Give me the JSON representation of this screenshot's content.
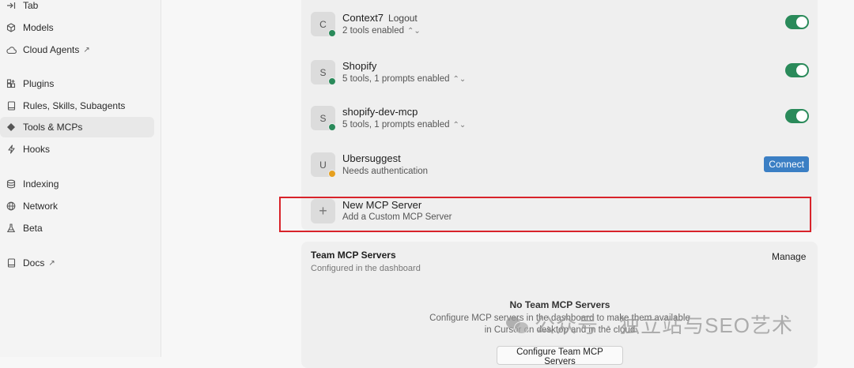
{
  "sidebar": {
    "items": [
      {
        "label": "Tab",
        "icon": "tab-arrow-icon",
        "external": false,
        "active": false
      },
      {
        "label": "Models",
        "icon": "cube-icon",
        "external": false,
        "active": false
      },
      {
        "label": "Cloud Agents",
        "icon": "cloud-icon",
        "external": true,
        "active": false
      },
      {
        "label": "Plugins",
        "icon": "plugins-icon",
        "external": false,
        "active": false
      },
      {
        "label": "Rules, Skills, Subagents",
        "icon": "book-icon",
        "external": false,
        "active": false
      },
      {
        "label": "Tools & MCPs",
        "icon": "tools-icon",
        "external": false,
        "active": true
      },
      {
        "label": "Hooks",
        "icon": "bolt-icon",
        "external": false,
        "active": false
      },
      {
        "label": "Indexing",
        "icon": "database-icon",
        "external": false,
        "active": false
      },
      {
        "label": "Network",
        "icon": "globe-icon",
        "external": false,
        "active": false
      },
      {
        "label": "Beta",
        "icon": "flask-icon",
        "external": false,
        "active": false
      },
      {
        "label": "Docs",
        "icon": "docs-icon",
        "external": true,
        "active": false
      }
    ],
    "external_glyph": "↗"
  },
  "servers": [
    {
      "initial": "C",
      "name": "Context7",
      "action": "Logout",
      "status": "2 tools enabled",
      "status_color": "#2a8a5a",
      "control": "toggle",
      "enabled": true
    },
    {
      "initial": "S",
      "name": "Shopify",
      "status": "5 tools, 1 prompts enabled",
      "status_color": "#2a8a5a",
      "control": "toggle",
      "enabled": true
    },
    {
      "initial": "S",
      "name": "shopify-dev-mcp",
      "status": "5 tools, 1 prompts enabled",
      "status_color": "#2a8a5a",
      "control": "toggle",
      "enabled": true
    },
    {
      "initial": "U",
      "name": "Ubersuggest",
      "status": "Needs authentication",
      "status_color": "#e6a020",
      "control": "button",
      "button_label": "Connect"
    }
  ],
  "new_server": {
    "icon": "+",
    "title": "New MCP Server",
    "subtitle": "Add a Custom MCP Server"
  },
  "team": {
    "title": "Team MCP Servers",
    "subtitle": "Configured in the dashboard",
    "manage_label": "Manage",
    "empty_title": "No Team MCP Servers",
    "empty_desc": "Configure MCP servers in the dashboard to make them available in Cursor on desktop and in the cloud",
    "button_label": "Configure Team MCP Servers"
  },
  "watermark": {
    "text": "公众号 · 独立站与SEO艺术"
  },
  "colors": {
    "toggle_on": "#2a8a5a",
    "connect": "#3b7fc4",
    "highlight": "#d8232a",
    "warning": "#e6a020"
  }
}
